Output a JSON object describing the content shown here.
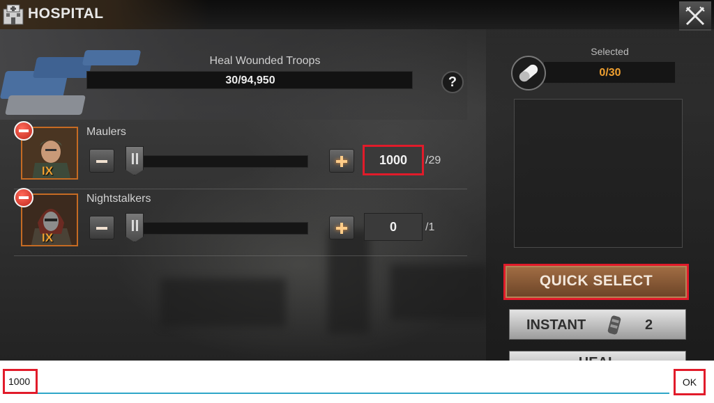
{
  "header": {
    "title": "HOSPITAL",
    "icon": "hospital-building-icon",
    "close_icon": "crossed-swords-close-icon"
  },
  "heal_section": {
    "label": "Heal Wounded Troops",
    "progress_text": "30/94,950",
    "help_label": "?"
  },
  "troops": [
    {
      "name": "Maulers",
      "tier": "IX",
      "quantity": "1000",
      "max": "/29",
      "slider_fraction": 0
    },
    {
      "name": "Nightstalkers",
      "tier": "IX",
      "quantity": "0",
      "max": "/1",
      "slider_fraction": 0
    }
  ],
  "right_panel": {
    "selected_label": "Selected",
    "selected_count": "0/30",
    "quick_select_label": "QUICK SELECT",
    "instant_label": "INSTANT",
    "instant_count": "2",
    "heal_label": "HEAL"
  },
  "input_bar": {
    "value": "1000",
    "ok_label": "OK"
  },
  "colors": {
    "accent_orange": "#f0a030",
    "highlight_red": "#e11b2a",
    "input_underline": "#2ea6c8",
    "portrait_border": "#c66b23"
  }
}
